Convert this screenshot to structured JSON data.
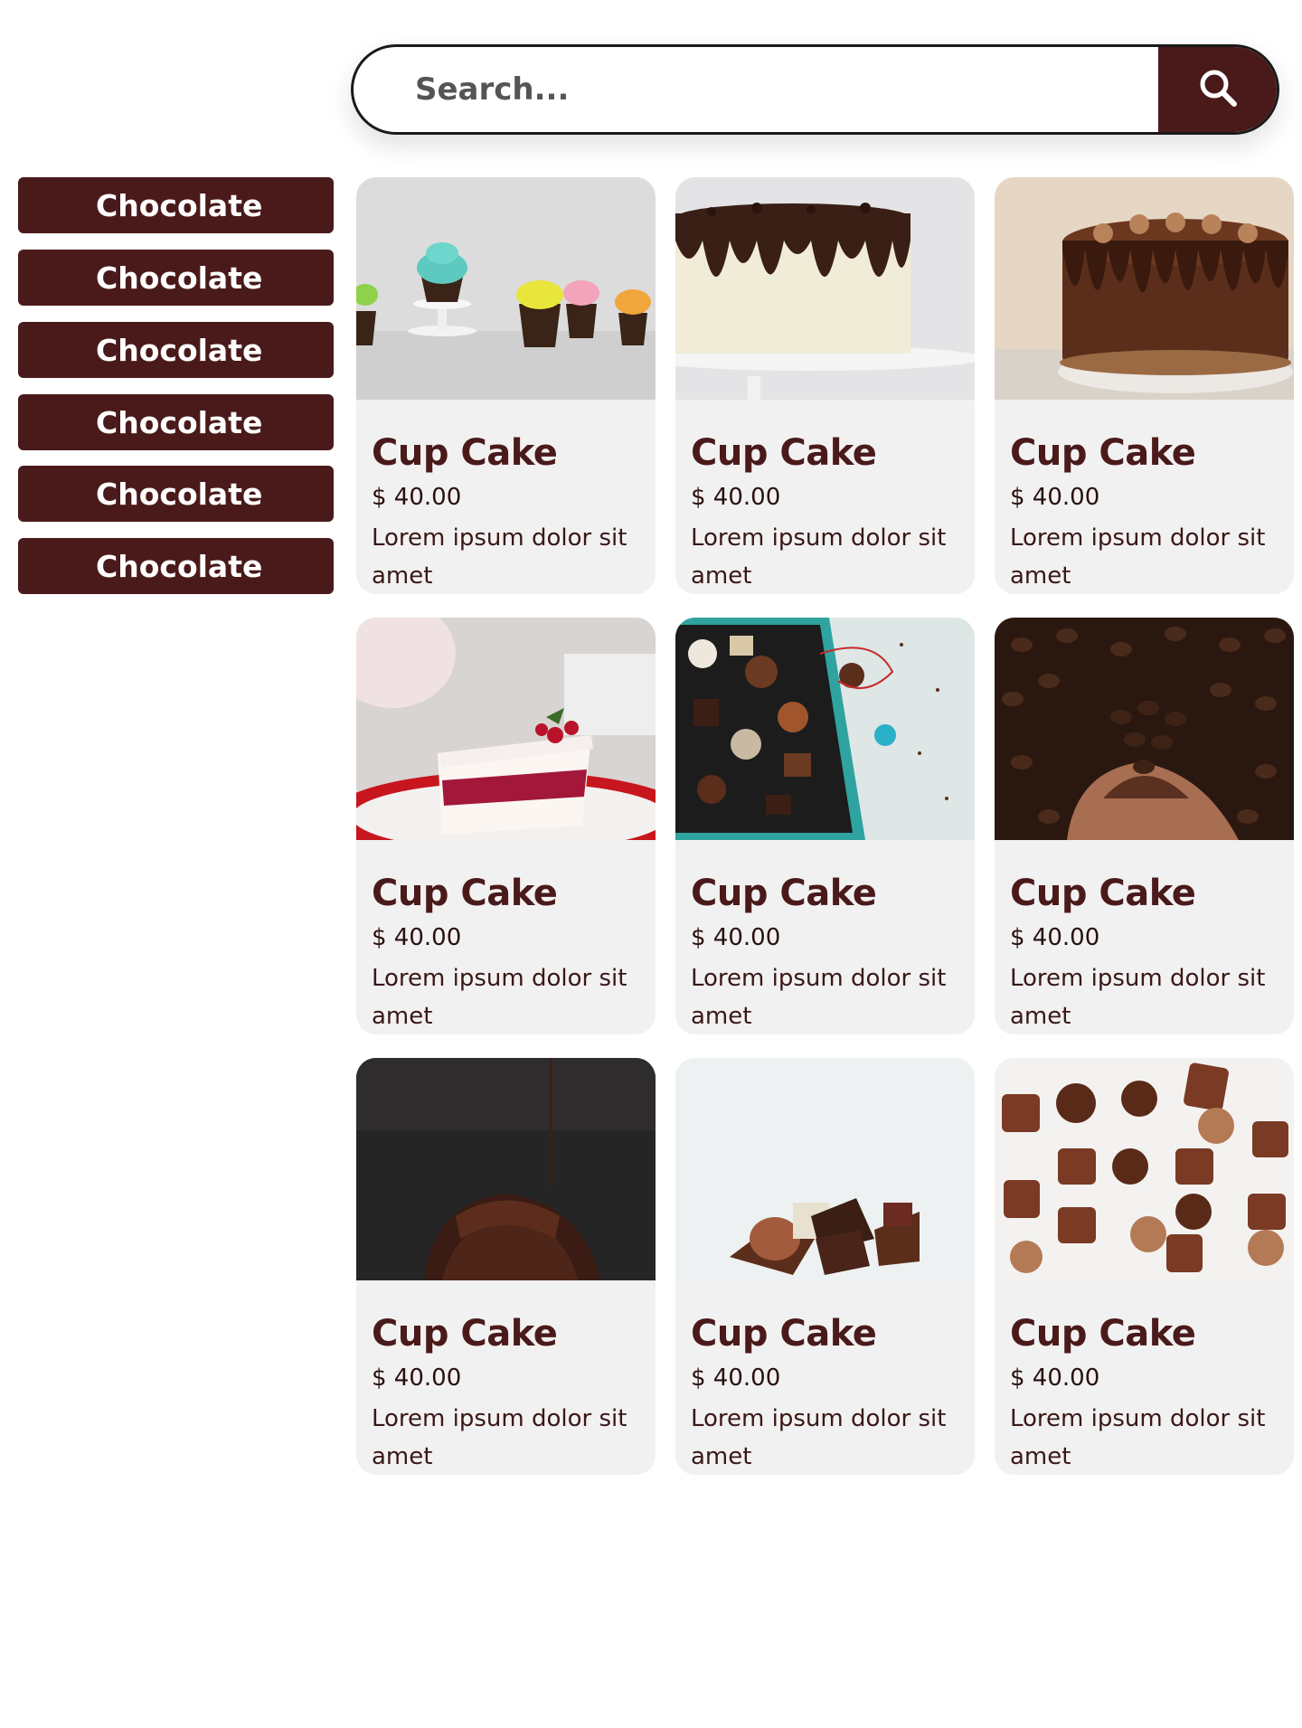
{
  "search": {
    "placeholder": "Search..."
  },
  "colors": {
    "brand": "#4a1a1a",
    "card_bg": "#f2f1f1",
    "page_bg": "#ffffff"
  },
  "categories": [
    {
      "label": "Chocolate"
    },
    {
      "label": "Chocolate"
    },
    {
      "label": "Chocolate"
    },
    {
      "label": "Chocolate"
    },
    {
      "label": "Chocolate"
    },
    {
      "label": "Chocolate"
    }
  ],
  "products": [
    {
      "title": "Cup Cake",
      "price": "$ 40.00",
      "description": "Lorem ipsum dolor sit amet",
      "image": "cupcakes"
    },
    {
      "title": "Cup Cake",
      "price": "$ 40.00",
      "description": "Lorem ipsum dolor sit amet",
      "image": "drip-cake-white"
    },
    {
      "title": "Cup Cake",
      "price": "$ 40.00",
      "description": "Lorem ipsum dolor sit amet",
      "image": "chocolate-drip-cake"
    },
    {
      "title": "Cup Cake",
      "price": "$ 40.00",
      "description": "Lorem ipsum dolor sit amet",
      "image": "red-velvet-slice"
    },
    {
      "title": "Cup Cake",
      "price": "$ 40.00",
      "description": "Lorem ipsum dolor sit amet",
      "image": "chocolate-box"
    },
    {
      "title": "Cup Cake",
      "price": "$ 40.00",
      "description": "Lorem ipsum dolor sit amet",
      "image": "cocoa-beans"
    },
    {
      "title": "Cup Cake",
      "price": "$ 40.00",
      "description": "Lorem ipsum dolor sit amet",
      "image": "bundt-cake"
    },
    {
      "title": "Cup Cake",
      "price": "$ 40.00",
      "description": "Lorem ipsum dolor sit amet",
      "image": "truffles"
    },
    {
      "title": "Cup Cake",
      "price": "$ 40.00",
      "description": "Lorem ipsum dolor sit amet",
      "image": "assorted-chocolates"
    }
  ]
}
